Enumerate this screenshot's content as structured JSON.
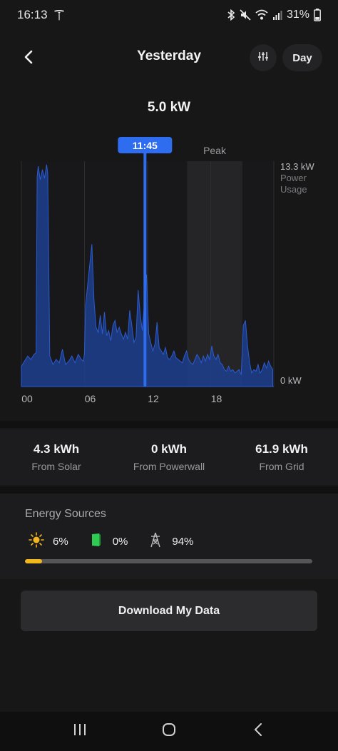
{
  "status_bar": {
    "time": "16:13",
    "battery": "31%",
    "icons": [
      "tesla-logo-icon",
      "bluetooth-icon",
      "mute-icon",
      "wifi-icon",
      "signal-icon",
      "battery-icon"
    ]
  },
  "header": {
    "title": "Yesterday",
    "range_label": "Day",
    "back_icon": "chevron-left-icon",
    "filter_icon": "sliders-icon"
  },
  "reading": "5.0 kW",
  "chart_data": {
    "type": "area",
    "selected_time_label": "11:45",
    "selected_hour": 11.75,
    "peak_label": "Peak",
    "peak_range": [
      15.75,
      21
    ],
    "y_max_label": "13.3 kW",
    "y_min_label": "0 kW",
    "y_axis_title": "Power\nUsage",
    "ylim": [
      0,
      13.3
    ],
    "xlim": [
      0,
      24
    ],
    "x_ticks": [
      {
        "hour": 0,
        "label": "00"
      },
      {
        "hour": 6,
        "label": "06"
      },
      {
        "hour": 12,
        "label": "12"
      },
      {
        "hour": 18,
        "label": "18"
      }
    ],
    "series": [
      {
        "color": "#1d3f8f",
        "x": [
          0,
          0.3,
          0.6,
          0.9,
          1.2,
          1.4,
          1.5,
          1.6,
          1.8,
          2.0,
          2.2,
          2.4,
          2.5,
          2.7,
          3.0,
          3.3,
          3.6,
          3.9,
          4.2,
          4.5,
          4.8,
          5.1,
          5.4,
          5.7,
          5.9,
          6.0,
          6.1,
          6.3,
          6.5,
          6.7,
          6.9,
          7.1,
          7.3,
          7.5,
          7.7,
          7.9,
          8.1,
          8.3,
          8.5,
          8.7,
          8.9,
          9.1,
          9.3,
          9.5,
          9.7,
          9.9,
          10.1,
          10.3,
          10.5,
          10.7,
          10.9,
          11.1,
          11.3,
          11.5,
          11.7,
          11.9,
          12.1,
          12.3,
          12.5,
          12.7,
          12.9,
          13.1,
          13.3,
          13.5,
          13.7,
          13.9,
          14.1,
          14.3,
          14.5,
          14.7,
          14.9,
          15.1,
          15.3,
          15.5,
          15.7,
          15.9,
          16.1,
          16.3,
          16.5,
          16.7,
          16.9,
          17.1,
          17.3,
          17.5,
          17.7,
          17.9,
          18.1,
          18.3,
          18.5,
          18.7,
          18.9,
          19.1,
          19.3,
          19.5,
          19.7,
          19.9,
          20.1,
          20.3,
          20.5,
          20.7,
          20.9,
          21.1,
          21.3,
          21.5,
          21.7,
          21.9,
          22.1,
          22.3,
          22.5,
          22.7,
          22.9,
          23.1,
          23.3,
          23.5,
          23.7,
          23.9
        ],
        "values": [
          1.2,
          1.5,
          1.8,
          1.6,
          1.9,
          2.0,
          12.4,
          13.0,
          12.2,
          12.8,
          12.3,
          13.1,
          12.6,
          1.8,
          1.3,
          1.6,
          1.4,
          2.2,
          1.3,
          1.5,
          1.8,
          1.4,
          1.9,
          1.6,
          1.5,
          2.0,
          4.8,
          6.0,
          7.2,
          8.4,
          5.1,
          3.5,
          3.2,
          4.2,
          3.1,
          4.4,
          3.0,
          3.3,
          2.7,
          3.6,
          3.9,
          3.2,
          3.5,
          3.1,
          2.8,
          3.2,
          2.8,
          4.5,
          3.6,
          2.6,
          2.9,
          5.7,
          4.2,
          3.3,
          5.0,
          6.6,
          3.1,
          2.6,
          2.1,
          2.5,
          3.8,
          2.3,
          2.1,
          1.9,
          2.3,
          1.7,
          1.6,
          1.8,
          2.1,
          1.7,
          1.6,
          1.5,
          1.4,
          1.8,
          2.1,
          1.6,
          1.4,
          1.3,
          1.6,
          1.9,
          1.7,
          1.4,
          1.8,
          1.5,
          1.9,
          1.6,
          2.4,
          1.8,
          1.6,
          1.9,
          1.4,
          1.3,
          1.0,
          0.9,
          1.2,
          0.9,
          1.0,
          0.8,
          0.9,
          1.0,
          0.7,
          3.6,
          3.9,
          2.4,
          1.4,
          0.8,
          1.0,
          0.9,
          1.3,
          0.8,
          1.0,
          1.4,
          1.1,
          1.5,
          1.2,
          1.0
        ]
      }
    ]
  },
  "stats": [
    {
      "value": "4.3 kWh",
      "label": "From Solar"
    },
    {
      "value": "0 kWh",
      "label": "From Powerwall"
    },
    {
      "value": "61.9 kWh",
      "label": "From Grid"
    }
  ],
  "energy_sources": {
    "title": "Energy Sources",
    "items": [
      {
        "icon": "sun-icon",
        "pct": "6%",
        "color": "#f0b61b"
      },
      {
        "icon": "powerwall-icon",
        "pct": "0%",
        "color": "#2ecc52"
      },
      {
        "icon": "grid-tower-icon",
        "pct": "94%",
        "color": "#bbbbbb"
      }
    ],
    "solar_fraction": 0.06
  },
  "download_label": "Download My Data",
  "nav": {
    "icons": [
      "recent-apps-icon",
      "home-icon",
      "back-nav-icon"
    ]
  }
}
